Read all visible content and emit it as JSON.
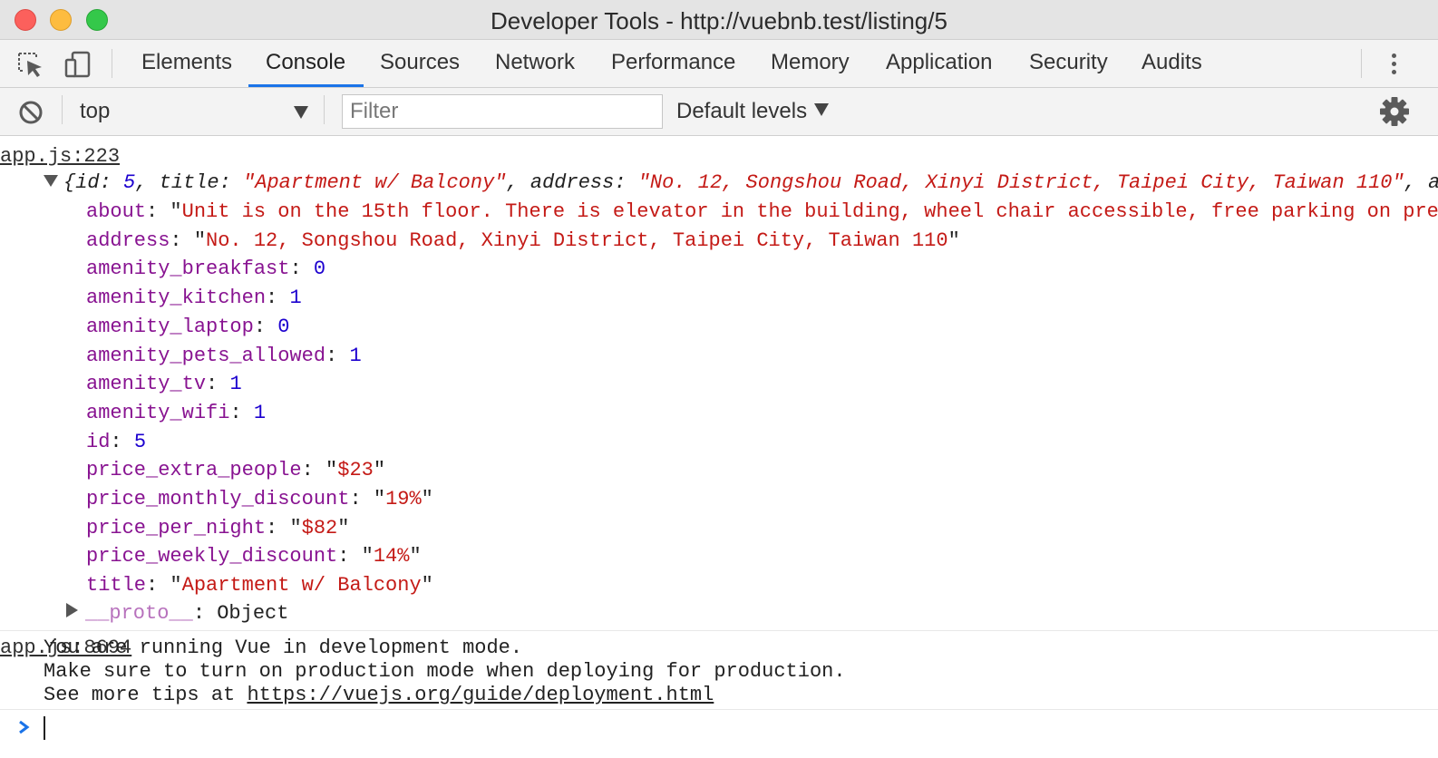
{
  "window": {
    "title": "Developer Tools - http://vuebnb.test/listing/5"
  },
  "tabs": [
    "Elements",
    "Console",
    "Sources",
    "Network",
    "Performance",
    "Memory",
    "Application",
    "Security",
    "Audits"
  ],
  "active_tab": "Console",
  "console_toolbar": {
    "context": "top",
    "filter_placeholder": "Filter",
    "levels": "Default levels"
  },
  "log_object": {
    "source": "app.js:223",
    "summary": {
      "open": "{",
      "id_key": "id",
      "id_val": "5",
      "title_key": "title",
      "title_val": "\"Apartment w/ Balcony\"",
      "address_key": "address",
      "address_val": "\"No. 12, Songshou Road, Xinyi District, Taipei City, Taiwan 110\"",
      "trail": ", a"
    },
    "properties": [
      {
        "key": "about",
        "value": "\"Unit is on the 15th floor. There is elevator in the building, wheel chair accessible, free parking on pre",
        "kind": "string"
      },
      {
        "key": "address",
        "value": "\"No. 12, Songshou Road, Xinyi District, Taipei City, Taiwan 110\"",
        "kind": "string"
      },
      {
        "key": "amenity_breakfast",
        "value": "0",
        "kind": "number"
      },
      {
        "key": "amenity_kitchen",
        "value": "1",
        "kind": "number"
      },
      {
        "key": "amenity_laptop",
        "value": "0",
        "kind": "number"
      },
      {
        "key": "amenity_pets_allowed",
        "value": "1",
        "kind": "number"
      },
      {
        "key": "amenity_tv",
        "value": "1",
        "kind": "number"
      },
      {
        "key": "amenity_wifi",
        "value": "1",
        "kind": "number"
      },
      {
        "key": "id",
        "value": "5",
        "kind": "number"
      },
      {
        "key": "price_extra_people",
        "value": "\"$23\"",
        "kind": "string"
      },
      {
        "key": "price_monthly_discount",
        "value": "\"19%\"",
        "kind": "string"
      },
      {
        "key": "price_per_night",
        "value": "\"$82\"",
        "kind": "string"
      },
      {
        "key": "price_weekly_discount",
        "value": "\"14%\"",
        "kind": "string"
      },
      {
        "key": "title",
        "value": "\"Apartment w/ Balcony\"",
        "kind": "string"
      }
    ],
    "proto": {
      "key": "__proto__",
      "value": "Object"
    }
  },
  "vue_message": {
    "source": "app.js:8694",
    "line1": "You are running Vue in development mode.",
    "line2": "Make sure to turn on production mode when deploying for production.",
    "line3_prefix": "See more tips at ",
    "line3_link": "https://vuejs.org/guide/deployment.html"
  },
  "icons": {
    "inspect": "inspect-element-icon",
    "device": "device-toolbar-icon",
    "clear": "clear-console-icon",
    "settings": "gear-icon",
    "more": "more-options-icon",
    "prompt": "chevron-right-icon"
  },
  "colors": {
    "accent": "#1a73e8",
    "property_key": "#881391",
    "string": "#c41a16",
    "number": "#1c00cf"
  }
}
